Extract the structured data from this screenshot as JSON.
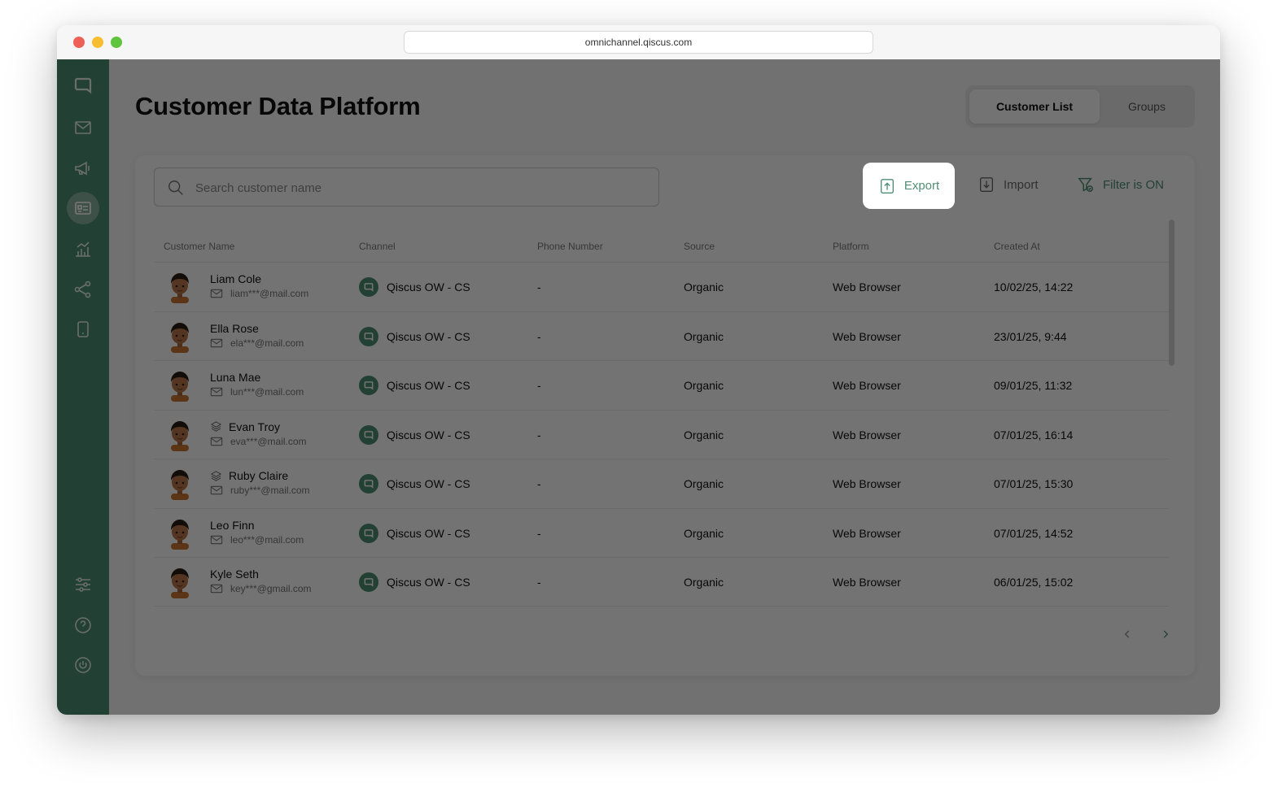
{
  "browser": {
    "url": "omnichannel.qiscus.com"
  },
  "colors": {
    "brand": "#4f8f76",
    "overlay": "rgba(0,0,0,0.55)"
  },
  "sidebar": {
    "items": [
      {
        "icon": "chat-logo-icon"
      },
      {
        "icon": "mail-icon"
      },
      {
        "icon": "megaphone-icon"
      },
      {
        "icon": "contact-card-icon",
        "active": true
      },
      {
        "icon": "analytics-icon"
      },
      {
        "icon": "share-nodes-icon"
      },
      {
        "icon": "mobile-device-icon"
      }
    ],
    "bottom_items": [
      {
        "icon": "settings-sliders-icon"
      },
      {
        "icon": "help-icon"
      },
      {
        "icon": "power-icon"
      }
    ]
  },
  "page": {
    "title": "Customer Data Platform"
  },
  "tabs": {
    "customer_list": "Customer List",
    "groups": "Groups"
  },
  "toolbar": {
    "search_placeholder": "Search customer name",
    "export_label": "Export",
    "import_label": "Import",
    "filter_label": "Filter is ON"
  },
  "table": {
    "headers": {
      "name": "Customer Name",
      "channel": "Channel",
      "phone": "Phone Number",
      "source": "Source",
      "platform": "Platform",
      "created": "Created At"
    },
    "rows": [
      {
        "name": "Liam Cole",
        "email": "liam***@mail.com",
        "group": false,
        "channel": "Qiscus OW - CS",
        "phone": "-",
        "source": "Organic",
        "platform": "Web Browser",
        "created": "10/02/25, 14:22"
      },
      {
        "name": "Ella Rose",
        "email": "ela***@mail.com",
        "group": false,
        "channel": "Qiscus OW - CS",
        "phone": "-",
        "source": "Organic",
        "platform": "Web Browser",
        "created": "23/01/25, 9:44"
      },
      {
        "name": "Luna Mae",
        "email": "lun***@mail.com",
        "group": false,
        "channel": "Qiscus OW - CS",
        "phone": "-",
        "source": "Organic",
        "platform": "Web Browser",
        "created": "09/01/25, 11:32"
      },
      {
        "name": "Evan Troy",
        "email": "eva***@mail.com",
        "group": true,
        "channel": "Qiscus OW - CS",
        "phone": "-",
        "source": "Organic",
        "platform": "Web Browser",
        "created": "07/01/25, 16:14"
      },
      {
        "name": "Ruby Claire",
        "email": "ruby***@mail.com",
        "group": true,
        "channel": "Qiscus OW - CS",
        "phone": "-",
        "source": "Organic",
        "platform": "Web Browser",
        "created": "07/01/25, 15:30"
      },
      {
        "name": "Leo Finn",
        "email": "leo***@mail.com",
        "group": false,
        "channel": "Qiscus OW - CS",
        "phone": "-",
        "source": "Organic",
        "platform": "Web Browser",
        "created": "07/01/25, 14:52"
      },
      {
        "name": "Kyle Seth",
        "email": "key***@gmail.com",
        "group": false,
        "channel": "Qiscus OW - CS",
        "phone": "-",
        "source": "Organic",
        "platform": "Web Browser",
        "created": "06/01/25, 15:02"
      }
    ]
  }
}
